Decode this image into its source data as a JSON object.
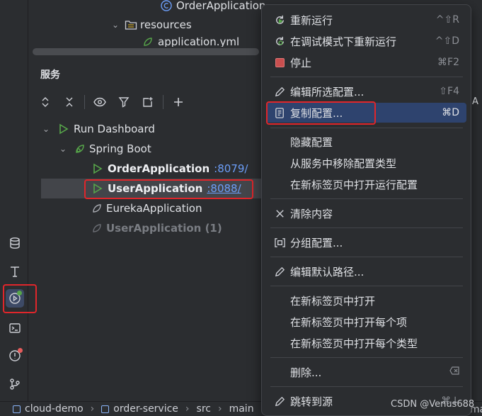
{
  "project_tree": {
    "order_application": "OrderApplication",
    "resources": "resources",
    "application_yml": "application.yml"
  },
  "services": {
    "title": "服务",
    "run_dashboard": "Run Dashboard",
    "spring_boot": "Spring Boot",
    "order_app": "OrderApplication",
    "order_port": ":8079/",
    "user_app": "UserApplication",
    "user_port": ":8088/",
    "eureka_app": "EurekaApplication",
    "user_app_1": "UserApplication (1)"
  },
  "context_menu": {
    "rerun": {
      "label": "重新运行",
      "shortcut": "^⇧R"
    },
    "rerun_debug": {
      "label": "在调试模式下重新运行",
      "shortcut": "^⇧D"
    },
    "stop": {
      "label": "停止",
      "shortcut": "⌘F2"
    },
    "edit_selected": {
      "label": "编辑所选配置...",
      "shortcut": "⇧F4"
    },
    "copy_config": {
      "label": "复制配置...",
      "shortcut": "⌘D"
    },
    "hide_config": {
      "label": "隐藏配置"
    },
    "remove_type": {
      "label": "从服务中移除配置类型"
    },
    "open_run_config_tab": {
      "label": "在新标签页中打开运行配置"
    },
    "clear": {
      "label": "清除内容"
    },
    "group": {
      "label": "分组配置..."
    },
    "edit_default_path": {
      "label": "编辑默认路径..."
    },
    "open_new_tab": {
      "label": "在新标签页中打开"
    },
    "open_each_item": {
      "label": "在新标签页中打开每个项"
    },
    "open_each_type": {
      "label": "在新标签页中打开每个类型"
    },
    "delete": {
      "label": "删除..."
    },
    "jump_to_source": {
      "label": "跳转到源",
      "shortcut": "⌘↓"
    }
  },
  "status_bar": {
    "project": "cloud-demo",
    "module": "order-service",
    "src": "src",
    "main": "main",
    "map_peek": "map"
  },
  "side_peek": "A",
  "watermark": "CSDN @Venus688",
  "colors": {
    "accent_blue": "#2e436e",
    "highlight_red": "#e0262b",
    "run_green": "#57a64a",
    "link_blue": "#6c9ef8"
  },
  "icons": [
    "database-icon",
    "text-icon",
    "services-icon",
    "terminal-icon",
    "problems-icon",
    "git-icon"
  ]
}
